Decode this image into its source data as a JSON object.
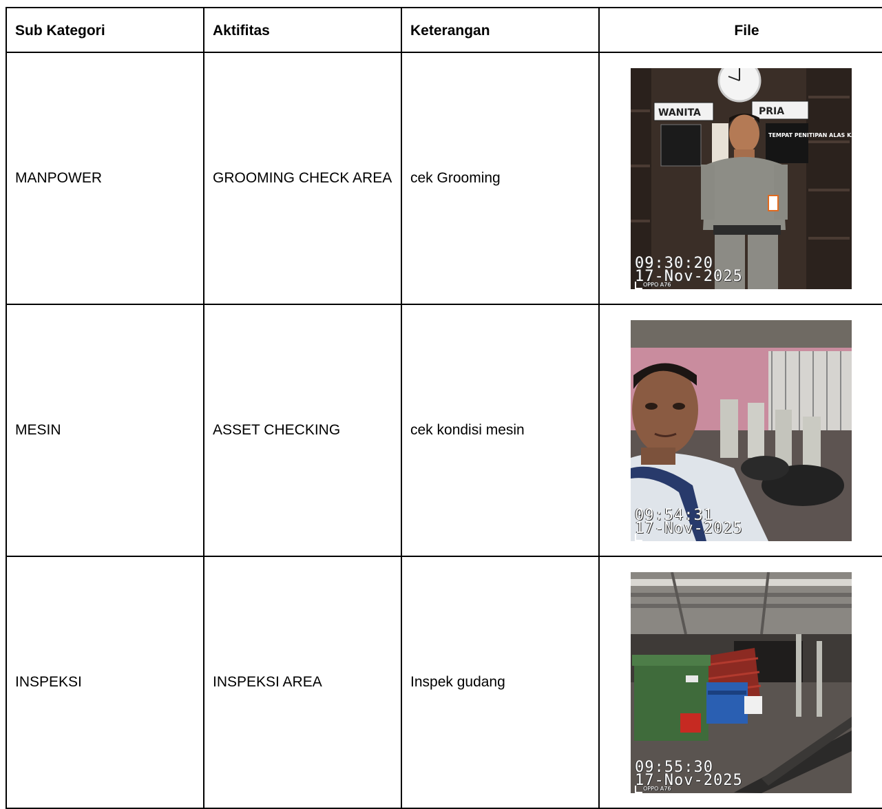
{
  "table": {
    "headers": [
      "Sub Kategori",
      "Aktifitas",
      "Keterangan",
      "File"
    ],
    "rows": [
      {
        "sub_kategori": "MANPOWER",
        "aktifitas": "GROOMING CHECK AREA",
        "keterangan": "cek Grooming",
        "file": {
          "time": "09:30:20",
          "date": "17-Nov-2025",
          "brand": "OPPO A76",
          "sign_left": "WANITA",
          "sign_right": "PRIA",
          "notice": "TEMPAT PENITIPAN ALAS KAKI"
        }
      },
      {
        "sub_kategori": "MESIN",
        "aktifitas": "ASSET CHECKING",
        "keterangan": "cek kondisi mesin",
        "file": {
          "time": "09:54:31",
          "date": "17-Nov-2025"
        }
      },
      {
        "sub_kategori": "INSPEKSI",
        "aktifitas": "INSPEKSI AREA",
        "keterangan": "Inspek gudang",
        "file": {
          "time": "09:55:30",
          "date": "17-Nov-2025",
          "brand": "OPPO A76"
        }
      }
    ]
  }
}
